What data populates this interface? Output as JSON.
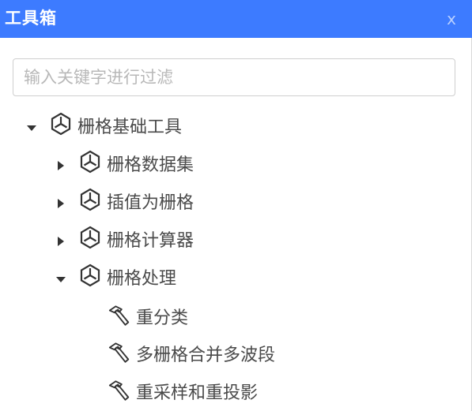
{
  "header": {
    "title": "工具箱",
    "close_label": "x",
    "background": "#3d7bff"
  },
  "search": {
    "placeholder": "输入关键字进行过滤",
    "value": ""
  },
  "tree": {
    "root": {
      "label": "栅格基础工具",
      "expanded": true,
      "icon": "cube-icon"
    },
    "groups": [
      {
        "label": "栅格数据集",
        "expanded": false,
        "icon": "cube-icon"
      },
      {
        "label": "插值为栅格",
        "expanded": false,
        "icon": "cube-icon"
      },
      {
        "label": "栅格计算器",
        "expanded": false,
        "icon": "cube-icon"
      },
      {
        "label": "栅格处理",
        "expanded": true,
        "icon": "cube-icon"
      }
    ],
    "tools": [
      {
        "label": "重分类",
        "icon": "hammer-icon"
      },
      {
        "label": "多栅格合并多波段",
        "icon": "hammer-icon"
      },
      {
        "label": "重采样和重投影",
        "icon": "hammer-icon"
      }
    ]
  }
}
